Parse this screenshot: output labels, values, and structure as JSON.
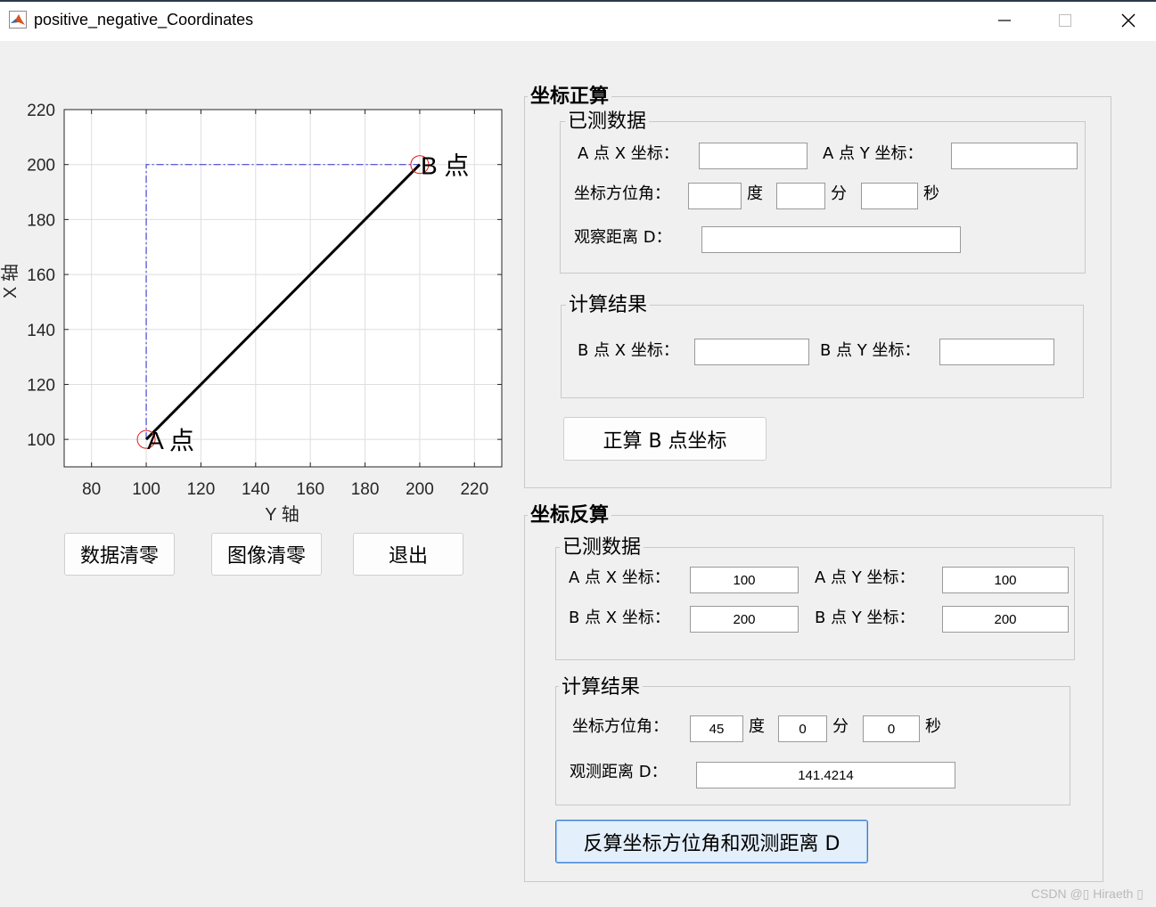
{
  "window": {
    "title": "positive_negative_Coordinates"
  },
  "chart_data": {
    "type": "line",
    "xlabel": "Y 轴",
    "ylabel": "X 轴",
    "xlim": [
      70,
      230
    ],
    "ylim": [
      90,
      220
    ],
    "xticks": [
      "80",
      "100",
      "120",
      "140",
      "160",
      "180",
      "200",
      "220"
    ],
    "yticks": [
      "100",
      "120",
      "140",
      "160",
      "180",
      "200",
      "220"
    ],
    "grid": true,
    "series": [
      {
        "name": "",
        "style": "solid-black",
        "x": [
          100,
          200
        ],
        "y": [
          100,
          200
        ]
      },
      {
        "name": "",
        "style": "dashdot-blue",
        "x": [
          100,
          100,
          200
        ],
        "y": [
          100,
          200,
          200
        ]
      }
    ],
    "markers": [
      {
        "x": 100,
        "y": 100,
        "label": "A 点"
      },
      {
        "x": 200,
        "y": 200,
        "label": "B 点"
      }
    ]
  },
  "left_buttons": {
    "clear_data": "数据清零",
    "clear_image": "图像清零",
    "exit": "退出"
  },
  "forward": {
    "title": "坐标正算",
    "measured": {
      "title": "已测数据",
      "ax_label": "A 点 X 坐标：",
      "ax_value": "",
      "ay_label": "A 点 Y 坐标：",
      "ay_value": "",
      "azimuth_label": "坐标方位角：",
      "deg_value": "",
      "deg_unit": "度",
      "min_value": "",
      "min_unit": "分",
      "sec_value": "",
      "sec_unit": "秒",
      "dist_label": "观察距离 D：",
      "dist_value": ""
    },
    "result": {
      "title": "计算结果",
      "bx_label": "B 点 X 坐标：",
      "bx_value": "",
      "by_label": "B 点 Y 坐标：",
      "by_value": ""
    },
    "button": "正算 B 点坐标"
  },
  "inverse": {
    "title": "坐标反算",
    "measured": {
      "title": "已测数据",
      "ax_label": "A 点 X 坐标：",
      "ax_value": "100",
      "ay_label": "A 点 Y 坐标：",
      "ay_value": "100",
      "bx_label": "B 点 X 坐标：",
      "bx_value": "200",
      "by_label": "B 点 Y 坐标：",
      "by_value": "200"
    },
    "result": {
      "title": "计算结果",
      "azimuth_label": "坐标方位角：",
      "deg_value": "45",
      "deg_unit": "度",
      "min_value": "0",
      "min_unit": "分",
      "sec_value": "0",
      "sec_unit": "秒",
      "dist_label": "观测距离 D：",
      "dist_value": "141.4214"
    },
    "button": "反算坐标方位角和观测距离 D"
  },
  "watermark": "CSDN @▯ Hiraeth ▯"
}
